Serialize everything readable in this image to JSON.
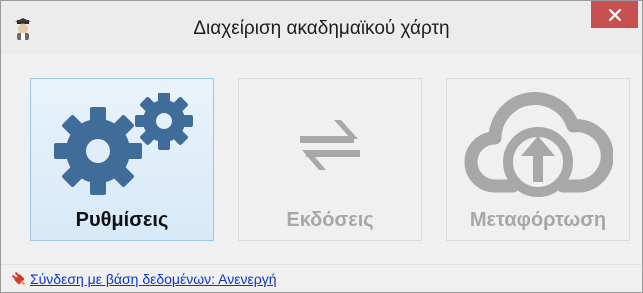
{
  "window": {
    "title": "Διαχείριση ακαδημαϊκού χάρτη",
    "close_icon": "close-icon",
    "app_icon": "app-logo-icon"
  },
  "tiles": [
    {
      "label": "Ρυθμίσεις",
      "icon": "gears-icon",
      "state": "active"
    },
    {
      "label": "Εκδόσεις",
      "icon": "swap-arrows-icon",
      "state": "disabled"
    },
    {
      "label": "Μεταφόρτωση",
      "icon": "cloud-upload-icon",
      "state": "disabled"
    }
  ],
  "status": {
    "link_text": "Σύνδεση με βάση δεδομένων: Ανενεργή",
    "icon": "plug-icon"
  },
  "colors": {
    "active_icon": "#3f6c98",
    "disabled_icon": "#a8a8a8",
    "close_button": "#c75050",
    "link": "#0b36c9"
  }
}
